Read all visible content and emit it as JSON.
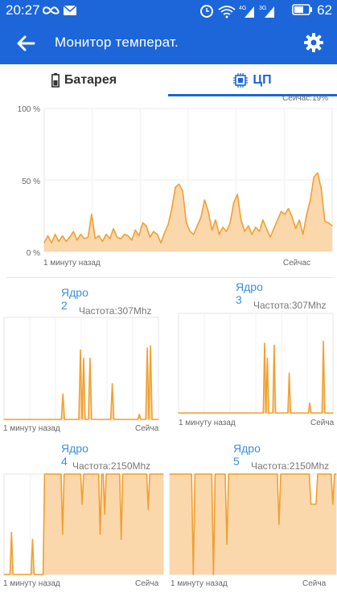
{
  "status_bar": {
    "time": "20:27",
    "battery": "62",
    "network_tag_1": "4G",
    "network_tag_2": "3G",
    "icons": [
      "infinity-icon",
      "mail-icon",
      "alarm-icon",
      "wifi-icon",
      "signal-icon",
      "signal-icon",
      "battery-icon"
    ]
  },
  "app_bar": {
    "title": "Монитор температ.",
    "back_icon": "arrow-left-icon",
    "settings_icon": "gear-icon"
  },
  "tabs": [
    {
      "label": "Батарея",
      "icon": "battery-icon",
      "selected": false
    },
    {
      "label": "ЦП",
      "icon": "cpu-icon",
      "selected": true
    }
  ],
  "colors": {
    "accent": "#1c66d9",
    "line": "#f0a030",
    "fill": "#fbd7ac",
    "core_title": "#3d8fd8"
  },
  "main_chart": {
    "now_text": "Сейчас:19%",
    "y_labels": [
      "100 %",
      "50 %",
      "0 %"
    ],
    "x_start": "1 минуту назад",
    "x_end": "Сейчас"
  },
  "cores": [
    {
      "title": "Ядро 2",
      "freq": "Частота:307Mhz",
      "x_start": "1 минуту назад",
      "x_end": "Сейча"
    },
    {
      "title": "Ядро 3",
      "freq": "Частота:307Mhz",
      "x_start": "1 минуту назад",
      "x_end": "Сейча"
    },
    {
      "title": "Ядро 4",
      "freq": "Частота:2150Mhz",
      "x_start": "1 минуту назад",
      "x_end": "Сейча"
    },
    {
      "title": "Ядро 5",
      "freq": "Частота:2150Mhz",
      "x_start": "1 минуту назад",
      "x_end": "Сейча"
    }
  ],
  "chart_data": [
    {
      "type": "area",
      "series": [
        {
          "values": [
            6,
            11,
            6,
            12,
            7,
            11,
            7,
            10,
            14,
            8,
            12,
            9,
            10,
            26,
            9,
            11,
            7,
            12,
            9,
            16,
            10,
            9,
            12,
            11,
            8,
            15,
            11,
            20,
            18,
            10,
            14,
            12,
            6,
            13,
            19,
            30,
            45,
            47,
            42,
            20,
            14,
            12,
            18,
            24,
            36,
            28,
            15,
            22,
            12,
            17,
            14,
            20,
            34,
            40,
            22,
            14,
            18,
            12,
            17,
            14,
            22,
            16,
            10,
            16,
            22,
            28,
            26,
            30,
            24,
            16,
            22,
            12,
            26,
            36,
            52,
            55,
            44,
            21,
            20,
            18
          ]
        }
      ],
      "ylim": [
        0,
        100
      ],
      "x_labels": [
        "1 минуту назад",
        "Сейчас"
      ]
    },
    {
      "type": "area",
      "series": [
        {
          "values": [
            0,
            0,
            0,
            0,
            0,
            0,
            0,
            0,
            0,
            0,
            0,
            0,
            0,
            0,
            0,
            0,
            0,
            0,
            0,
            0,
            0,
            0,
            0,
            0,
            0,
            0,
            0,
            0,
            0,
            0,
            0,
            0,
            0,
            0,
            0,
            0,
            0,
            25,
            0,
            0,
            0,
            0,
            0,
            0,
            0,
            0,
            0,
            0,
            68,
            0,
            60,
            0,
            0,
            0,
            60,
            0,
            0,
            0,
            0,
            0,
            0,
            0,
            0,
            0,
            0,
            0,
            0,
            0,
            35,
            0,
            0,
            0,
            0,
            0,
            0,
            0,
            0,
            0,
            0,
            0,
            0,
            0,
            0,
            0,
            0,
            5,
            0,
            0,
            0,
            0,
            70,
            0,
            72,
            0,
            0,
            0,
            0,
            0
          ]
        }
      ],
      "ylim": [
        0,
        100
      ]
    },
    {
      "type": "area",
      "series": [
        {
          "values": [
            0,
            0,
            0,
            0,
            0,
            0,
            0,
            0,
            0,
            0,
            0,
            0,
            0,
            0,
            0,
            0,
            0,
            0,
            0,
            0,
            0,
            0,
            0,
            0,
            0,
            0,
            0,
            0,
            0,
            0,
            0,
            0,
            0,
            0,
            0,
            0,
            0,
            0,
            0,
            0,
            0,
            0,
            0,
            0,
            0,
            0,
            0,
            0,
            0,
            0,
            0,
            0,
            0,
            0,
            0,
            0,
            0,
            0,
            0,
            0,
            0,
            0,
            0,
            70,
            0,
            55,
            0,
            0,
            0,
            0,
            68,
            0,
            0,
            0,
            0,
            0,
            0,
            0,
            0,
            0,
            0,
            40,
            0,
            0,
            0,
            0,
            0,
            0,
            0,
            0,
            0,
            0,
            0,
            0,
            0,
            0,
            10,
            0,
            0,
            0,
            0,
            0,
            0,
            0,
            0,
            0,
            72,
            0,
            0,
            0,
            0,
            0,
            0,
            0
          ]
        }
      ],
      "ylim": [
        0,
        100
      ]
    },
    {
      "type": "area",
      "series": [
        {
          "values": [
            0,
            0,
            0,
            0,
            0,
            42,
            0,
            0,
            0,
            0,
            0,
            0,
            0,
            0,
            0,
            0,
            0,
            0,
            0,
            35,
            0,
            0,
            0,
            0,
            0,
            0,
            0,
            100,
            100,
            100,
            100,
            100,
            100,
            100,
            100,
            100,
            100,
            100,
            100,
            40,
            100,
            100,
            100,
            100,
            100,
            100,
            100,
            100,
            100,
            100,
            100,
            100,
            70,
            100,
            100,
            100,
            100,
            100,
            100,
            100,
            100,
            100,
            100,
            100,
            40,
            100,
            100,
            60,
            100,
            100,
            100,
            100,
            100,
            100,
            100,
            100,
            100,
            100,
            35,
            100,
            100,
            100,
            100,
            100,
            100,
            100,
            100,
            100,
            100,
            100,
            100,
            100,
            100,
            100,
            100,
            100,
            65,
            100,
            100,
            100,
            100,
            100,
            100,
            100,
            100,
            100,
            100
          ]
        }
      ],
      "ylim": [
        0,
        100
      ]
    },
    {
      "type": "area",
      "series": [
        {
          "values": [
            100,
            100,
            100,
            100,
            100,
            100,
            100,
            100,
            100,
            100,
            100,
            100,
            100,
            100,
            0,
            100,
            100,
            100,
            100,
            100,
            100,
            100,
            100,
            100,
            100,
            100,
            0,
            100,
            100,
            100,
            100,
            100,
            100,
            100,
            30,
            100,
            100,
            100,
            100,
            100,
            100,
            100,
            100,
            100,
            100,
            100,
            100,
            100,
            100,
            100,
            100,
            100,
            100,
            100,
            100,
            100,
            100,
            100,
            100,
            100,
            100,
            100,
            100,
            100,
            100,
            50,
            100,
            100,
            100,
            100,
            100,
            100,
            100,
            100,
            100,
            100,
            100,
            100,
            100,
            100,
            100,
            100,
            100,
            100,
            70,
            70,
            70,
            70,
            100,
            100,
            100,
            100,
            100,
            100,
            100,
            100,
            100,
            70,
            100,
            100
          ]
        }
      ],
      "ylim": [
        0,
        100
      ]
    }
  ]
}
